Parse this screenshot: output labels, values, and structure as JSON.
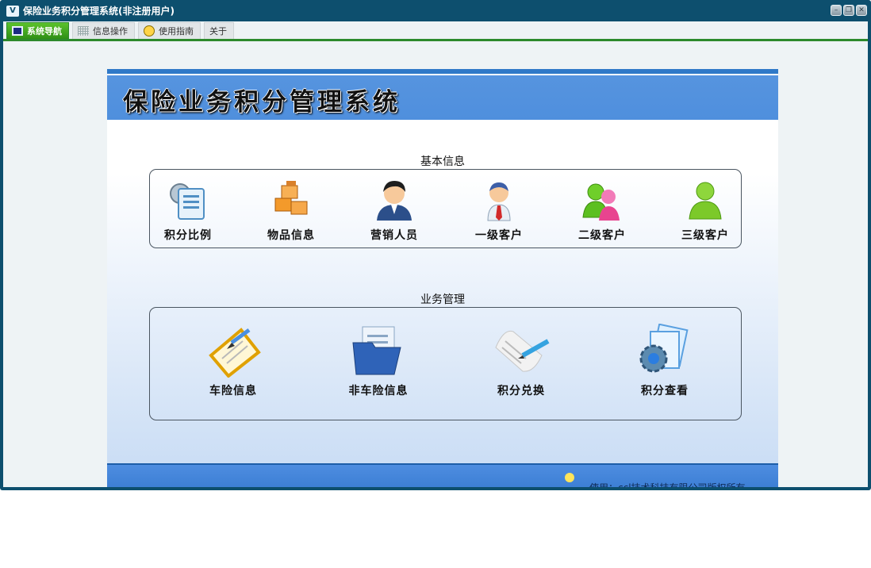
{
  "window": {
    "title": "保险业务积分管理系统(非注册用户)",
    "app_icon_text": "V",
    "controls": [
      "–",
      "❐",
      "✕"
    ]
  },
  "tabs": [
    {
      "label": "系统导航",
      "active": true,
      "icon": "monitor-icon"
    },
    {
      "label": "信息操作",
      "active": false,
      "icon": "grid-icon"
    },
    {
      "label": "使用指南",
      "active": false,
      "icon": "smile-icon"
    },
    {
      "label": "关于",
      "active": false,
      "icon": ""
    }
  ],
  "banner": {
    "title": "保险业务积分管理系统"
  },
  "basic_info": {
    "label": "基本信息",
    "items": [
      {
        "label": "积分比例",
        "icon": "settings-document-icon"
      },
      {
        "label": "物品信息",
        "icon": "boxes-icon"
      },
      {
        "label": "营销人员",
        "icon": "salesperson-icon"
      },
      {
        "label": "一级客户",
        "icon": "person-icon"
      },
      {
        "label": "二级客户",
        "icon": "group-icon"
      },
      {
        "label": "三级客户",
        "icon": "user-icon"
      }
    ]
  },
  "business": {
    "label": "业务管理",
    "items": [
      {
        "label": "车险信息",
        "icon": "clipboard-icon"
      },
      {
        "label": "非车险信息",
        "icon": "folder-icon"
      },
      {
        "label": "积分兑换",
        "icon": "note-pen-icon"
      },
      {
        "label": "积分查看",
        "icon": "gear-documents-icon"
      }
    ]
  },
  "footer": {
    "text": "使用：ccl技术科技有限公司版权所有"
  },
  "colors": {
    "window_frame": "#0d4f6e",
    "tab_active": "#2e8f16",
    "banner": "#4f8fdd"
  }
}
